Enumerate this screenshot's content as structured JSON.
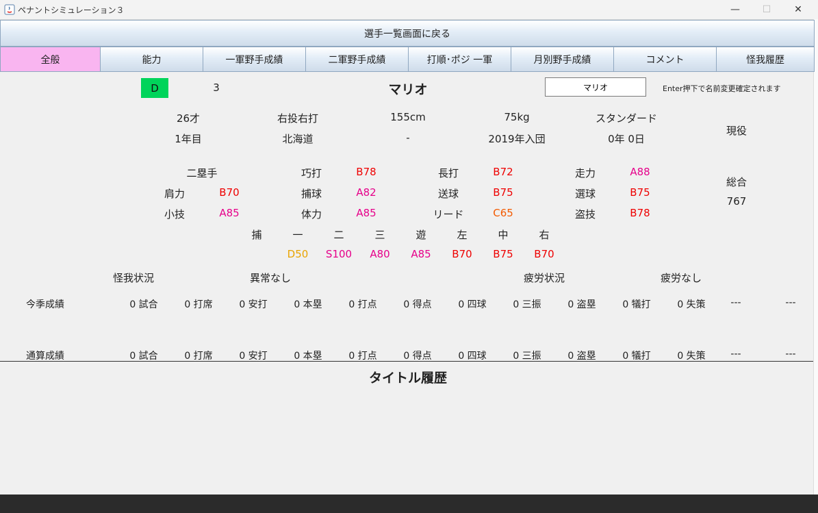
{
  "window": {
    "title": "ペナントシミュレーション３",
    "minimize": "—",
    "maximize": "☐",
    "close": "✕"
  },
  "back_button": "選手一覧画面に戻る",
  "tabs": [
    "全般",
    "能力",
    "一軍野手成績",
    "二軍野手成績",
    "打順･ポジ 一軍",
    "月別野手成績",
    "コメント",
    "怪我履歴"
  ],
  "player": {
    "grade": "D",
    "number": "3",
    "name": "マリオ",
    "name_input_value": "マリオ",
    "name_hint": "Enter押下で名前変更確定されます"
  },
  "profile": {
    "age": "26才",
    "throw_bat": "右投右打",
    "height": "155cm",
    "weight": "75kg",
    "type": "スタンダード",
    "years": "1年目",
    "hometown": "北海道",
    "dash": "-",
    "joined": "2019年入団",
    "contract": "0年 0日",
    "status": "現役"
  },
  "abilities": {
    "position": "二塁手",
    "items": [
      {
        "label": "巧打",
        "value": "B78",
        "color": "#ee0000"
      },
      {
        "label": "長打",
        "value": "B72",
        "color": "#ee0000"
      },
      {
        "label": "走力",
        "value": "A88",
        "color": "#e6008a"
      },
      {
        "label": "肩力",
        "value": "B70",
        "color": "#ee0000"
      },
      {
        "label": "捕球",
        "value": "A82",
        "color": "#e6008a"
      },
      {
        "label": "送球",
        "value": "B75",
        "color": "#ee0000"
      },
      {
        "label": "選球",
        "value": "B75",
        "color": "#ee0000"
      },
      {
        "label": "小技",
        "value": "A85",
        "color": "#e6008a"
      },
      {
        "label": "体力",
        "value": "A85",
        "color": "#e6008a"
      },
      {
        "label": "リード",
        "value": "C65",
        "color": "#f35a00"
      },
      {
        "label": "盗技",
        "value": "B78",
        "color": "#ee0000"
      }
    ],
    "overall_label": "総合",
    "overall_value": "767"
  },
  "fielding": {
    "positions": [
      "捕",
      "一",
      "二",
      "三",
      "遊",
      "左",
      "中",
      "右"
    ],
    "values": [
      {
        "value": "D50",
        "color": "#e9a400"
      },
      {
        "value": "S100",
        "color": "#e6008a"
      },
      {
        "value": "A80",
        "color": "#e6008a"
      },
      {
        "value": "A85",
        "color": "#e6008a"
      },
      {
        "value": "B70",
        "color": "#ee0000"
      },
      {
        "value": "B75",
        "color": "#ee0000"
      },
      {
        "value": "B70",
        "color": "#ee0000"
      }
    ]
  },
  "condition": {
    "injury_label": "怪我状況",
    "injury_value": "異常なし",
    "fatigue_label": "疲労状況",
    "fatigue_value": "疲労なし"
  },
  "records": {
    "season_label": "今季成績",
    "career_label": "通算成績",
    "stats": [
      "0 試合",
      "0 打席",
      "0 安打",
      "0 本塁",
      "0 打点",
      "0 得点",
      "0 四球",
      "0 三振",
      "0 盗塁",
      "0 犠打",
      "0 失策",
      "---",
      "---"
    ]
  },
  "title_history": "タイトル履歴"
}
